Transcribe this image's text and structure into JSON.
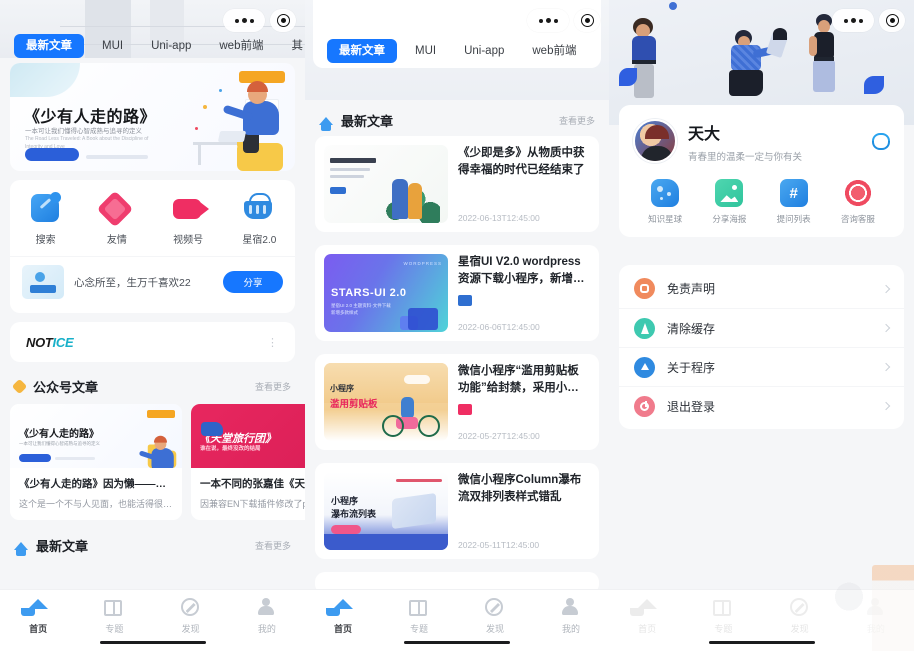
{
  "capsule": {
    "more_label": "•••",
    "target_label": "target-icon"
  },
  "panel1": {
    "nav_tabs": [
      {
        "label": "最新文章",
        "active": true
      },
      {
        "label": "MUI",
        "active": false
      },
      {
        "label": "Uni-app",
        "active": false
      },
      {
        "label": "web前端",
        "active": false
      },
      {
        "label": "其",
        "active": false
      }
    ],
    "banner": {
      "title": "《少有人走的路》",
      "subtitle": "一本可让我们懂得心智成熟与追寻的定义",
      "subtitle_en": "The Road Less Traveled:  A Book about the Discipline of Integrity and Love",
      "tag": ""
    },
    "quick_grid": [
      {
        "label": "搜索",
        "icon": "search-icon"
      },
      {
        "label": "友情",
        "icon": "heart-icon"
      },
      {
        "label": "视频号",
        "icon": "video-icon"
      },
      {
        "label": "星宿2.0",
        "icon": "basket-icon"
      }
    ],
    "share": {
      "text": "心念所至，生万千喜欢22",
      "button": "分享"
    },
    "notice": {
      "logo_a": "NOT",
      "logo_b": "ICE",
      "menu": "⋮"
    },
    "section_public": {
      "title": "公众号文章",
      "more": "查看更多"
    },
    "public_cards": [
      {
        "cover_title": "《少有人走的路》",
        "cover_sub": "一本可让我们懂得心智成熟与追寻的定义",
        "title": "《少有人走的路》因为懒——终我…",
        "desc": "这个是一个不与人见面，也能活得很好…"
      },
      {
        "cover_title": "《天堂旅行团》",
        "cover_sub": "谁在说，最终没改的结局",
        "title": "一本不同的张嘉佳《天堂…",
        "desc": "因兼容EN下载插件修改了p…"
      }
    ],
    "section_latest": {
      "title": "最新文章",
      "more": "查看更多"
    }
  },
  "panel2": {
    "nav_tabs": [
      {
        "label": "最新文章",
        "active": true
      },
      {
        "label": "MUI",
        "active": false
      },
      {
        "label": "Uni-app",
        "active": false
      },
      {
        "label": "web前端",
        "active": false
      },
      {
        "label": "其",
        "active": false
      }
    ],
    "section_latest": {
      "title": "最新文章",
      "more": "查看更多"
    },
    "articles": [
      {
        "title": "《少即是多》从物质中获得幸福的时代已经结束了",
        "date": "2022-06-13T12:45:00",
        "thumb": "people-plants-illustration",
        "badge": null
      },
      {
        "title": "星宿UI V2.0 wordpress资源下载小程序，新增文件下…",
        "date": "2022-06-06T12:45:00",
        "thumb": "stars-ui-2.0-cover",
        "thumb_title": "STARS-UI 2.0",
        "badge": "#2f6fd0"
      },
      {
        "title": "微信小程序“滥用剪贴板功能”给封禁，采用小程序…",
        "date": "2022-05-27T12:45:00",
        "thumb": "bicycle-clipboard-illustration",
        "thumb_title1": "小程序",
        "thumb_title2": "滥用剪贴板",
        "badge": "#ef2e63"
      },
      {
        "title": "微信小程序Column瀑布流双排列表样式错乱",
        "date": "2022-05-11T12:45:00",
        "thumb": "waterfall-list-cover",
        "thumb_title1": "小程序",
        "thumb_title2": "瀑布流列表",
        "badge": null
      }
    ]
  },
  "panel3": {
    "profile": {
      "name": "天大",
      "tagline": "青春里的温柔一定与你有关",
      "refresh_icon": "refresh-icon",
      "avatar": "user-avatar"
    },
    "quick_grid": [
      {
        "label": "知识星球",
        "icon": "planet-icon"
      },
      {
        "label": "分享海报",
        "icon": "image-icon"
      },
      {
        "label": "提问列表",
        "icon": "hash-icon",
        "glyph": "#"
      },
      {
        "label": "咨询客服",
        "icon": "headset-icon"
      }
    ],
    "menu": [
      {
        "label": "免责声明",
        "icon": "shield-icon",
        "color": "#f08a5d"
      },
      {
        "label": "清除缓存",
        "icon": "broom-icon",
        "color": "#3ec9b0"
      },
      {
        "label": "关于程序",
        "icon": "info-icon",
        "color": "#2f8ae0"
      },
      {
        "label": "退出登录",
        "icon": "power-icon",
        "color": "#f07b8c"
      }
    ]
  },
  "tabbar": [
    {
      "label": "首页",
      "icon": "home-icon",
      "active": true
    },
    {
      "label": "专题",
      "icon": "book-icon",
      "active": false
    },
    {
      "label": "发现",
      "icon": "compass-icon",
      "active": false
    },
    {
      "label": "我的",
      "icon": "user-icon",
      "active": false
    }
  ],
  "colors": {
    "accent": "#1677ff",
    "tab_active": "#3d9bf0",
    "muted": "#b0b5bc",
    "bg": "#f5f6f8"
  }
}
